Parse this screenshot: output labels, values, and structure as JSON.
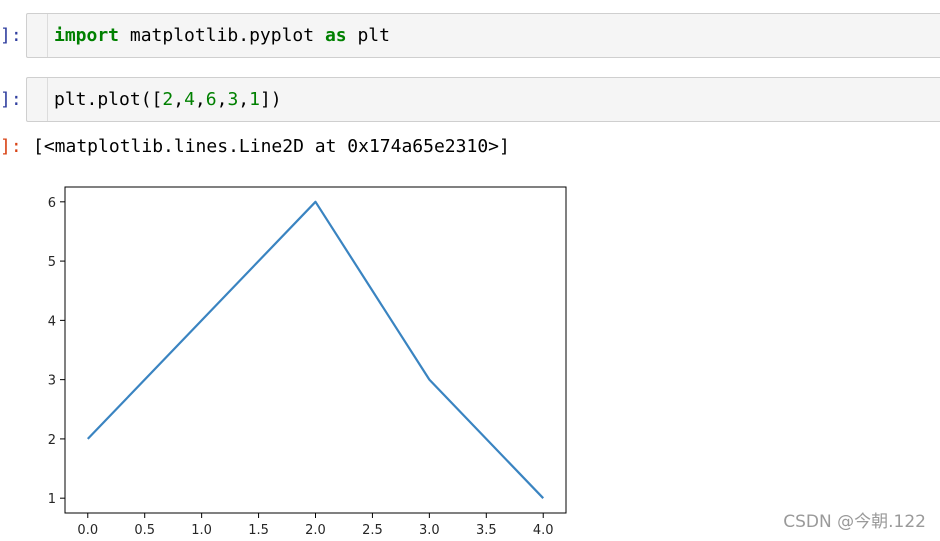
{
  "cells": [
    {
      "prompt": "]:",
      "code": {
        "kw1": "import",
        "mid": " matplotlib.pyplot ",
        "kw2": "as",
        "tail": " plt"
      }
    },
    {
      "prompt": "]:",
      "code": {
        "pre": "plt.plot([",
        "n1": "2",
        "c1": ",",
        "n2": "4",
        "c2": ",",
        "n3": "6",
        "c3": ",",
        "n4": "3",
        "c4": ",",
        "n5": "1",
        "post": "])"
      }
    }
  ],
  "output": {
    "prompt": "]:",
    "text": "[<matplotlib.lines.Line2D at 0x174a65e2310>]"
  },
  "chart_data": {
    "type": "line",
    "x": [
      0,
      1,
      2,
      3,
      4
    ],
    "series": [
      {
        "values": [
          2,
          4,
          6,
          3,
          1
        ],
        "color": "#3a84c1"
      }
    ],
    "xticks": [
      "0.0",
      "0.5",
      "1.0",
      "1.5",
      "2.0",
      "2.5",
      "3.0",
      "3.5",
      "4.0"
    ],
    "yticks": [
      "1",
      "2",
      "3",
      "4",
      "5",
      "6"
    ],
    "xlim": [
      -0.2,
      4.2
    ],
    "ylim": [
      0.75,
      6.25
    ],
    "grid": false
  },
  "watermark": "CSDN @今朝.122"
}
